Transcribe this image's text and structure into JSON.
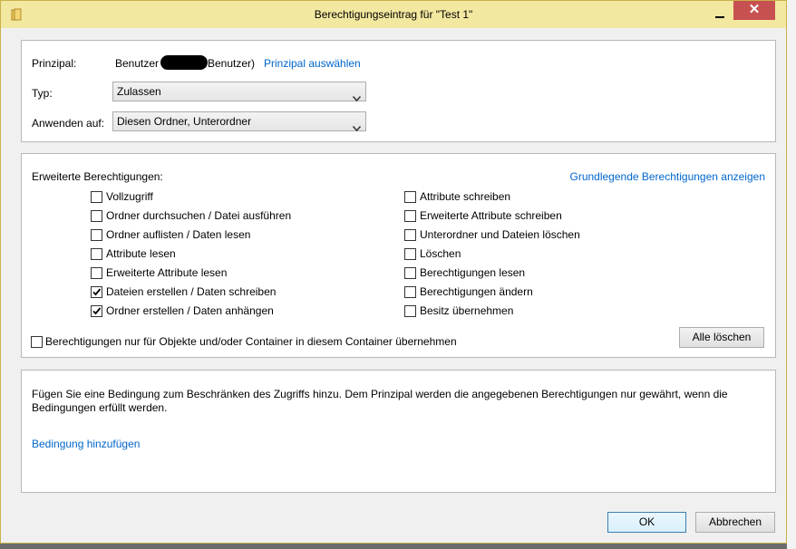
{
  "window": {
    "title": "Berechtigungseintrag für \"Test 1\"",
    "close_label": "✕",
    "accent_color": "#f3e89f"
  },
  "principal": {
    "label": "Prinzipal:",
    "value_prefix": "Benutzer (",
    "value_suffix": "Benutzer)",
    "select_link": "Prinzipal auswählen"
  },
  "type": {
    "label": "Typ:",
    "selected": "Zulassen"
  },
  "apply_to": {
    "label": "Anwenden auf:",
    "selected": "Diesen Ordner, Unterordner"
  },
  "permissions": {
    "heading": "Erweiterte Berechtigungen:",
    "basic_link": "Grundlegende Berechtigungen anzeigen",
    "left": [
      {
        "label": "Vollzugriff",
        "checked": false
      },
      {
        "label": "Ordner durchsuchen / Datei ausführen",
        "checked": false
      },
      {
        "label": "Ordner auflisten / Daten lesen",
        "checked": false
      },
      {
        "label": "Attribute lesen",
        "checked": false
      },
      {
        "label": "Erweiterte Attribute lesen",
        "checked": false
      },
      {
        "label": "Dateien erstellen / Daten schreiben",
        "checked": true
      },
      {
        "label": "Ordner erstellen / Daten anhängen",
        "checked": true
      }
    ],
    "right": [
      {
        "label": "Attribute schreiben",
        "checked": false
      },
      {
        "label": "Erweiterte Attribute schreiben",
        "checked": false
      },
      {
        "label": "Unterordner und Dateien löschen",
        "checked": false
      },
      {
        "label": "Löschen",
        "checked": false
      },
      {
        "label": "Berechtigungen lesen",
        "checked": false
      },
      {
        "label": "Berechtigungen ändern",
        "checked": false
      },
      {
        "label": "Besitz übernehmen",
        "checked": false
      }
    ],
    "inherit_only": {
      "label": "Berechtigungen nur für Objekte und/oder Container in diesem Container übernehmen",
      "checked": false
    },
    "clear_all": "Alle löschen"
  },
  "condition": {
    "text_line1": "Fügen Sie eine Bedingung zum Beschränken des Zugriffs hinzu. Dem Prinzipal werden die angegebenen Berechtigungen nur gewährt, wenn die",
    "text_line2": "Bedingungen erfüllt werden.",
    "add_link": "Bedingung hinzufügen"
  },
  "footer": {
    "ok": "OK",
    "cancel": "Abbrechen"
  }
}
